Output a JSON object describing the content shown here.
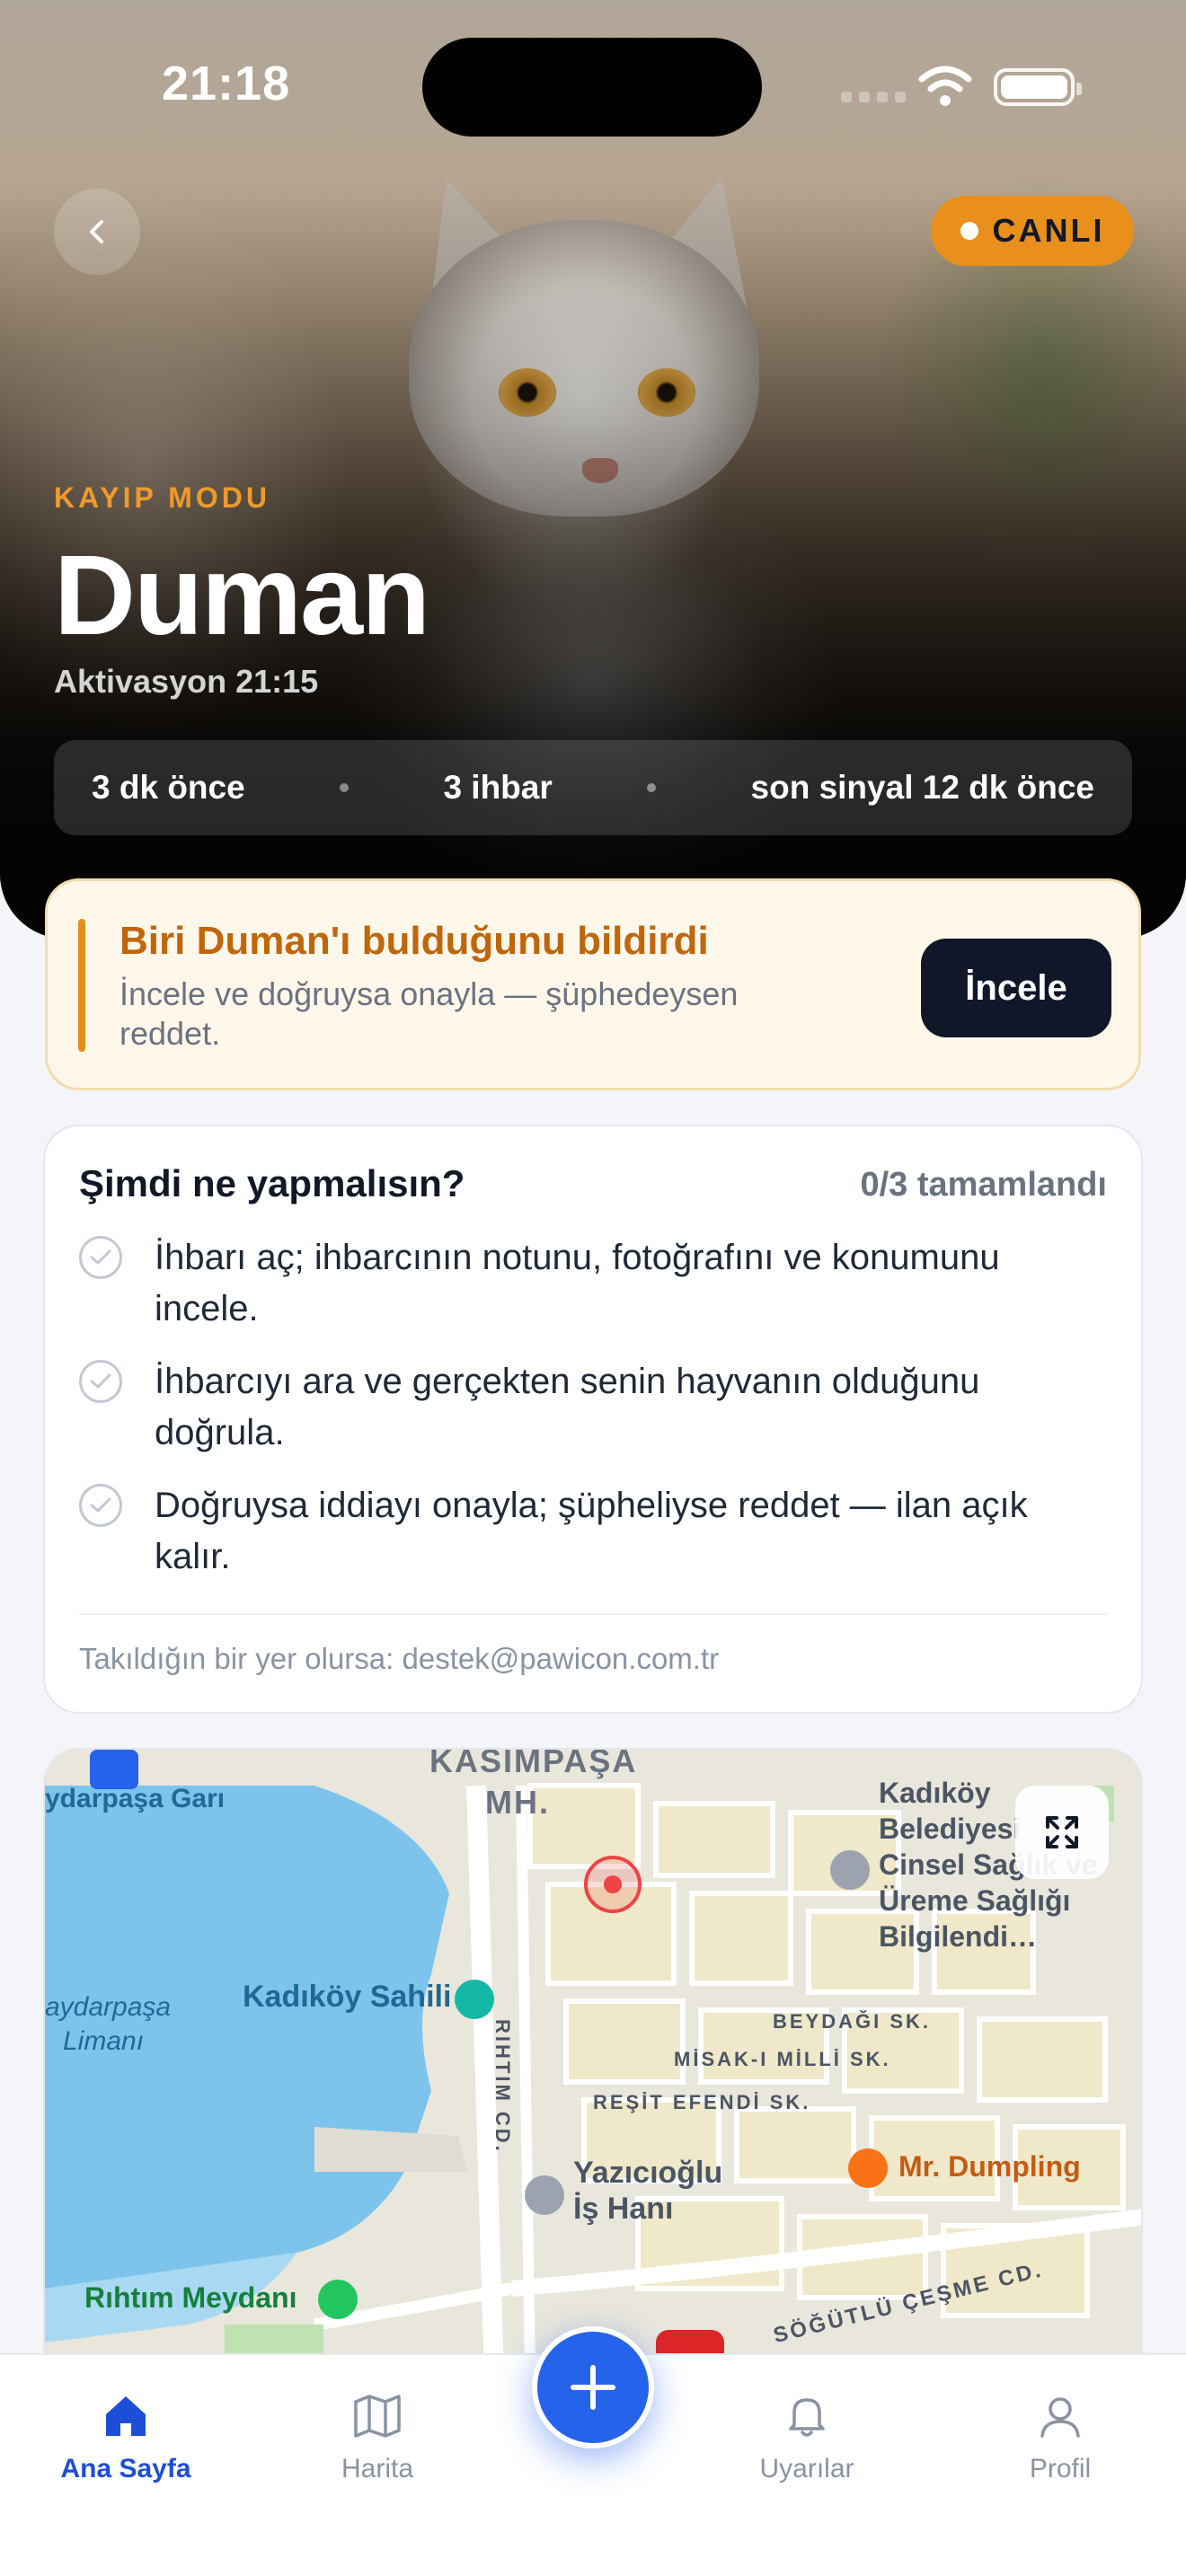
{
  "status_bar": {
    "time": "21:18"
  },
  "hero": {
    "live_badge": "CANLI",
    "mode_label": "KAYIP MODU",
    "pet_name": "Duman",
    "activation": "Aktivasyon 21:15",
    "stats": [
      "3 dk önce",
      "3 ihbar",
      "son sinyal 12 dk önce"
    ]
  },
  "alert": {
    "title": "Biri Duman'ı bulduğunu bildirdi",
    "subtitle": "İncele ve doğruysa onayla — şüphedeysen reddet.",
    "button": "İncele"
  },
  "checklist": {
    "title": "Şimdi ne yapmalısın?",
    "progress": "0/3 tamamlandı",
    "items": [
      "İhbarı aç; ihbarcının notunu, fotoğrafını ve konumunu incele.",
      "İhbarcıyı ara ve gerçekten senin hayvanın olduğunu doğrula.",
      "Doğruysa iddiayı onayla; şüpheliyse reddet — ilan açık kalır."
    ],
    "footer": "Takıldığın bir yer olursa: destek@pawicon.com.tr"
  },
  "map": {
    "labels": {
      "district": "KASIMPAŞA",
      "district2": "MH.",
      "station": "ydarpaşa Garı",
      "municipality": "Kadıköy Belediyesi Cinsel Sağlık ve Üreme Sağlığı Bilgilendi…",
      "beach": "Kadıköy Sahili",
      "harbor1": "aydarpaşa",
      "harbor2": "Limanı",
      "rihtim_street": "RIHTIM CD.",
      "beydagi": "BEYDAĞI SK.",
      "misak": "MİSAK-I MİLLİ SK.",
      "resit": "REŞİT EFENDİ SK.",
      "yazicioglu1": "Yazıcıoğlu",
      "yazicioglu2": "İş Hanı",
      "dumpling": "Mr. Dumpling",
      "square": "Rıhtım Meydanı",
      "sogutlu": "SÖĞÜTLÜ ÇEŞME CD."
    }
  },
  "tabs": {
    "home": "Ana Sayfa",
    "map": "Harita",
    "alerts": "Uyarılar",
    "profile": "Profil"
  },
  "colors": {
    "accent_orange": "#e88f1c",
    "primary_blue": "#2563eb",
    "navy": "#0f1729"
  }
}
